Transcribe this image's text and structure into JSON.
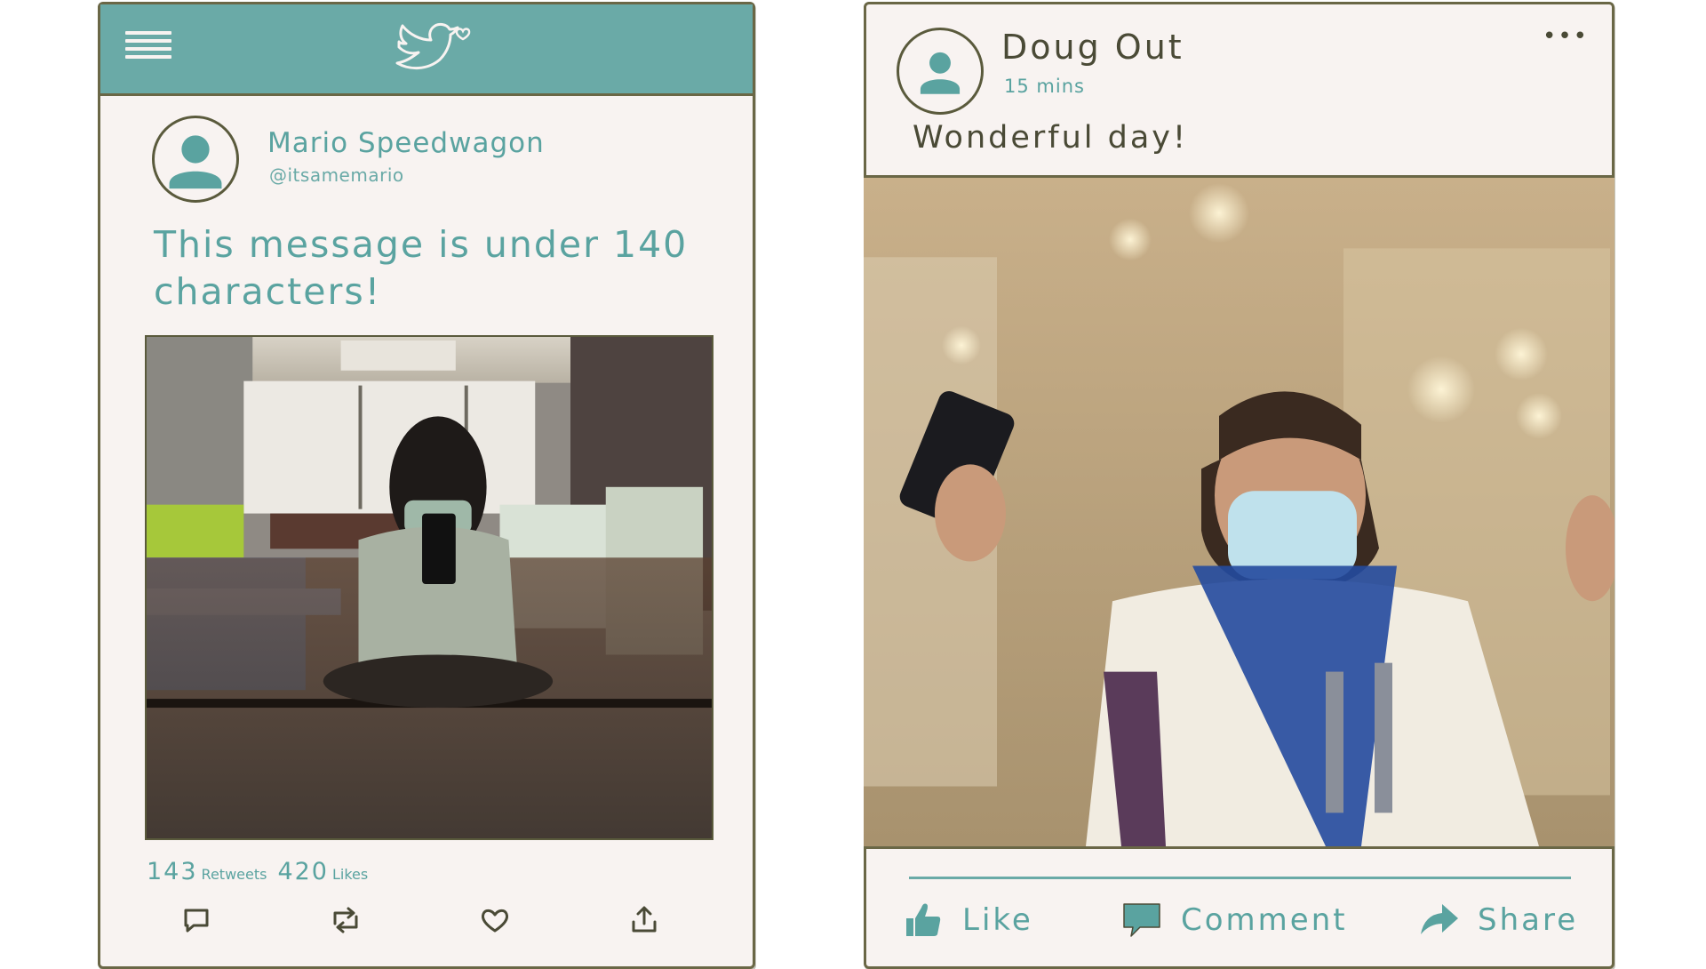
{
  "tweet_card": {
    "author_name": "Mario Speedwagon",
    "handle": "@itsamemario",
    "message": "This message is under 140 characters!",
    "retweets_count": "143",
    "retweets_label": "Retweets",
    "likes_count": "420",
    "likes_label": "Likes",
    "icons": {
      "menu": "menu-icon",
      "logo": "bird-logo-icon",
      "reply": "reply-icon",
      "retweet": "retweet-icon",
      "like": "heart-icon",
      "share": "share-icon"
    }
  },
  "fb_card": {
    "author_name": "Doug Out",
    "timestamp": "15 mins",
    "more": "•••",
    "status": "Wonderful day!",
    "actions": {
      "like": "Like",
      "comment": "Comment",
      "share": "Share"
    }
  },
  "colors": {
    "teal": "#6aaaa7",
    "teal_text": "#5aa3a0",
    "card_bg": "#f8f3f1",
    "border": "#6a6746",
    "dark_text": "#4a4a36"
  }
}
